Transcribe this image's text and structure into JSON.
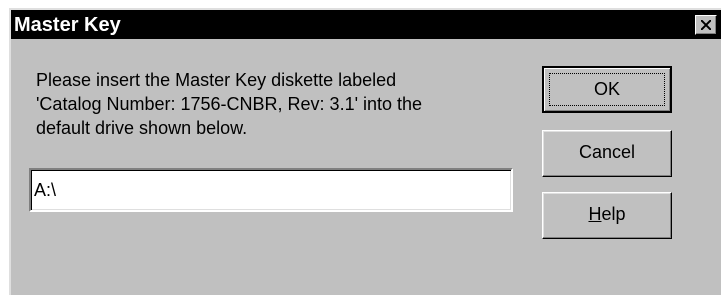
{
  "dialog": {
    "title": "Master Key",
    "close_glyph": "✕",
    "message": "Please insert the Master Key diskette labeled\n'Catalog Number: 1756-CNBR, Rev: 3.1' into the\ndefault drive shown below.",
    "drive_value": "A:\\"
  },
  "buttons": {
    "ok_label": "OK",
    "cancel_label": "Cancel",
    "help_mnemonic": "H",
    "help_rest": "elp"
  },
  "icons": {
    "close": "close-icon"
  },
  "colors": {
    "titlebar": "#000000",
    "title_text": "#ffffff",
    "face": "#c0c0c0"
  }
}
